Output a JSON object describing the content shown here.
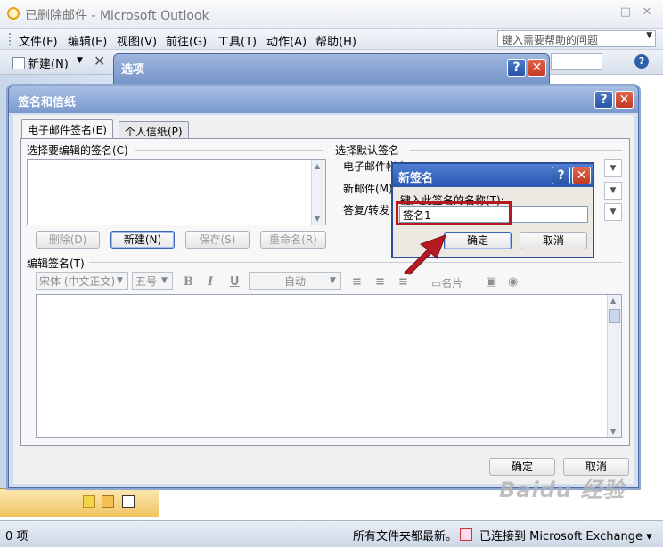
{
  "window": {
    "title": "已删除邮件 - Microsoft Outlook",
    "min": "–",
    "max": "□",
    "close": "✕"
  },
  "menu": {
    "items": [
      "文件(F)",
      "编辑(E)",
      "视图(V)",
      "前往(G)",
      "工具(T)",
      "动作(A)",
      "帮助(H)"
    ],
    "help_placeholder": "键入需要帮助的问题"
  },
  "toolbar": {
    "new_label": "新建(N)",
    "new_arrow": "▼",
    "delete_icon": "✕",
    "help_icon": "?"
  },
  "options_dialog": {
    "title": "选项",
    "help": "?",
    "close": "✕"
  },
  "sig_dialog": {
    "title": "签名和信纸",
    "help": "?",
    "close": "✕",
    "tabs": [
      "电子邮件签名(E)",
      "个人信纸(P)"
    ],
    "select_sig_label": "选择要编辑的签名(C)",
    "default_sig_label": "选择默认签名",
    "email_account_label": "电子邮件帐户",
    "new_messages_label": "新邮件(M)",
    "replies_label": "答复/转发",
    "buttons": {
      "delete": "删除(D)",
      "new": "新建(N)",
      "save": "保存(S)",
      "rename": "重命名(R)"
    },
    "edit_sig_label": "编辑签名(T)",
    "font": "宋体 (中文正文)",
    "font_size": "五号",
    "bold": "B",
    "italic": "I",
    "underline": "U",
    "color": "自动",
    "business_card": "名片",
    "ok": "确定",
    "cancel": "取消"
  },
  "new_sig_dialog": {
    "title": "新签名",
    "help": "?",
    "close": "✕",
    "prompt": "键入此签名的名称(T):",
    "value": "签名1",
    "ok": "确定",
    "cancel": "取消"
  },
  "status": {
    "items": "0 项",
    "message": "所有文件夹都最新。",
    "connection": "已连接到 Microsoft Exchange ▾"
  },
  "watermark": "Baidu 经验",
  "colors": {
    "highlight": "#b51a22",
    "caption_blue": "#2c57b0"
  }
}
